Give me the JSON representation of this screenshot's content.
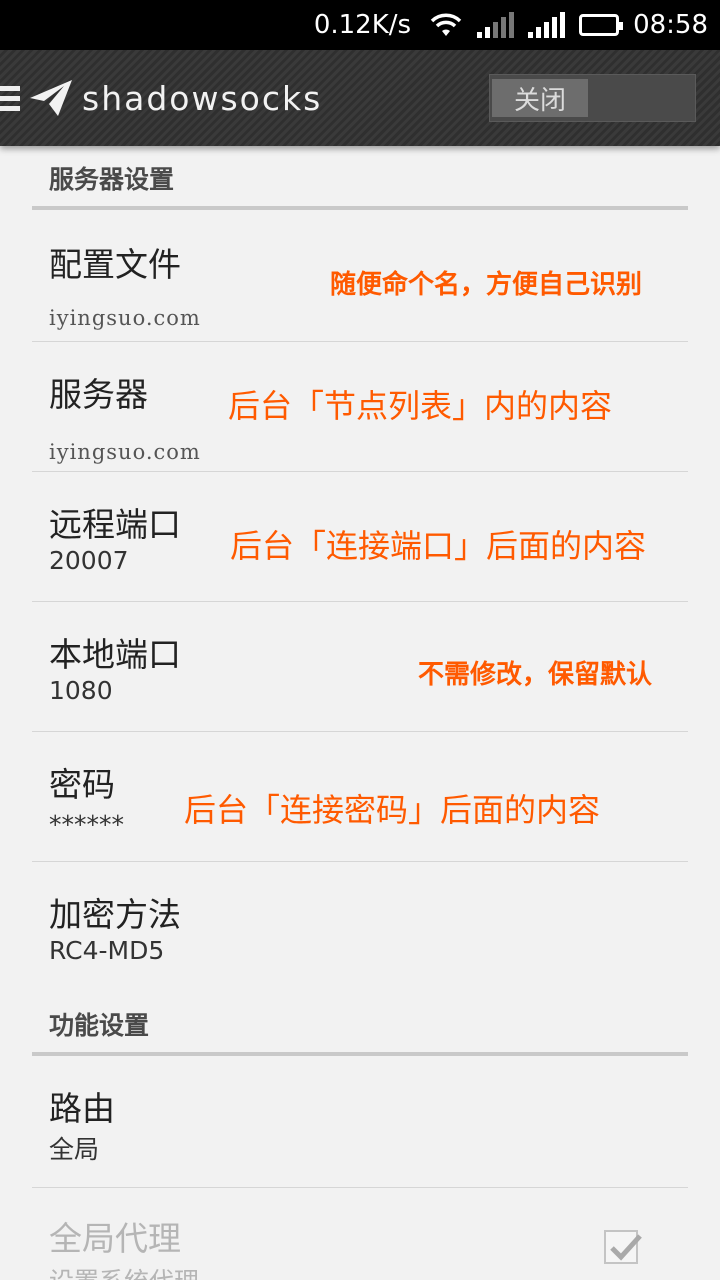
{
  "status_bar": {
    "net_speed": "0.12K/s",
    "time": "08:58",
    "icons": [
      "wifi-icon",
      "signal-icon",
      "signal-icon",
      "battery-icon"
    ]
  },
  "action_bar": {
    "app_name": "shadowsocks",
    "toggle_label": "关闭"
  },
  "sections": [
    {
      "header": "服务器设置",
      "items": [
        {
          "title": "配置文件",
          "summary": "iyingsuo.com",
          "note": "随便命个名，方便自己识别"
        },
        {
          "title": "服务器",
          "summary": "iyingsuo.com",
          "note": "后台「节点列表」内的内容"
        },
        {
          "title": "远程端口",
          "summary": "20007",
          "note": "后台「连接端口」后面的内容"
        },
        {
          "title": "本地端口",
          "summary": "1080",
          "note": "不需修改，保留默认"
        },
        {
          "title": "密码",
          "summary": "******",
          "note": "后台「连接密码」后面的内容"
        },
        {
          "title": "加密方法",
          "summary": "RC4-MD5"
        }
      ]
    },
    {
      "header": "功能设置",
      "items": [
        {
          "title": "路由",
          "summary": "全局"
        },
        {
          "title": "全局代理",
          "summary": "设置系统代理",
          "checked": true,
          "enabled": false
        }
      ]
    }
  ],
  "colors": {
    "note": "#ff5a00",
    "action_bar": "#333333",
    "background": "#f2f2f2"
  }
}
